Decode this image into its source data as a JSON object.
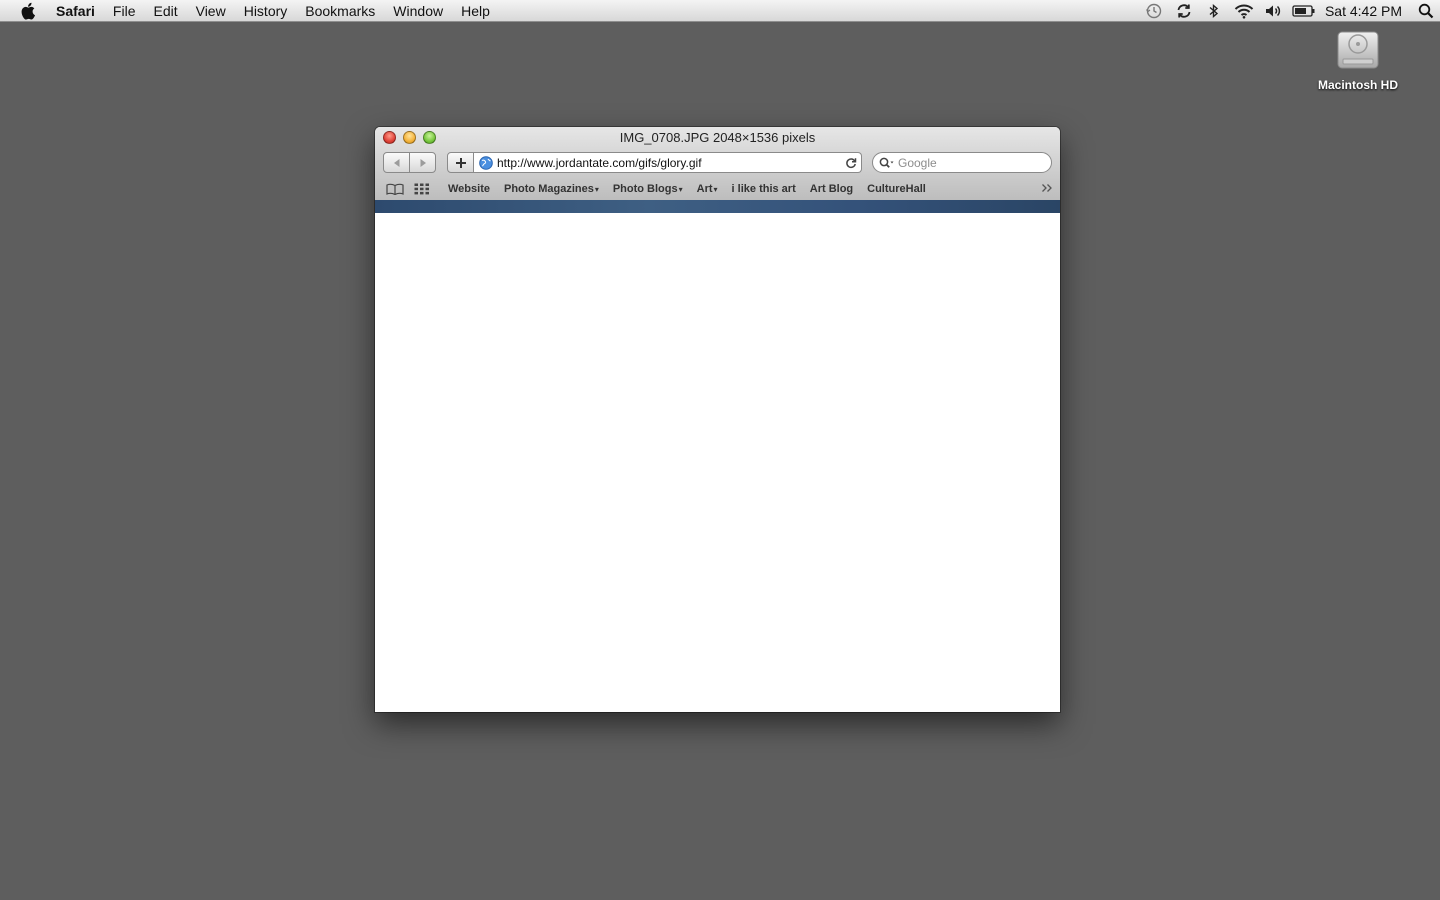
{
  "menubar": {
    "app": "Safari",
    "menus": [
      "File",
      "Edit",
      "View",
      "History",
      "Bookmarks",
      "Window",
      "Help"
    ],
    "clock": "Sat 4:42 PM"
  },
  "desktop": {
    "hd_label": "Macintosh HD"
  },
  "window": {
    "title": "IMG_0708.JPG 2048×1536 pixels",
    "url": "http://www.jordantate.com/gifs/glory.gif",
    "search_placeholder": "Google",
    "bookmarks": [
      {
        "label": "Website",
        "arrow": ""
      },
      {
        "label": "Photo Magazines",
        "arrow": "▾"
      },
      {
        "label": "Photo Blogs",
        "arrow": "▾"
      },
      {
        "label": "Art",
        "arrow": "▾"
      },
      {
        "label": "i like this art",
        "arrow": ""
      },
      {
        "label": "Art Blog",
        "arrow": ""
      },
      {
        "label": "CultureHall",
        "arrow": ""
      }
    ]
  },
  "colors": {
    "desktop": "#5e5e5e",
    "stripe": "#34527a"
  }
}
